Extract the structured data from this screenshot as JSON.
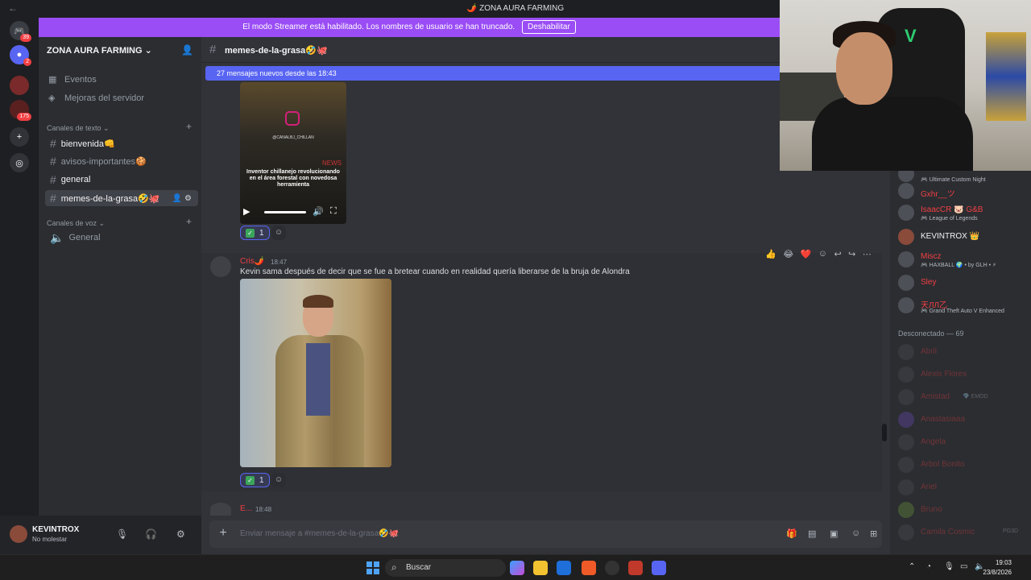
{
  "window": {
    "title": "🌶️ ZONA AURA FARMING",
    "back": "←"
  },
  "banner": {
    "text": "El modo Streamer está habilitado. Los nombres de usuario se han truncado.",
    "button": "Deshabilitar"
  },
  "guilds": [
    {
      "name": "discord-home",
      "badge": "39"
    },
    {
      "name": "server-2",
      "badge": "2"
    },
    {
      "name": "server-3",
      "badge": ""
    },
    {
      "name": "server-4",
      "badge": "175"
    }
  ],
  "sidebar": {
    "server_name": "ZONA AURA FARMING",
    "nav": [
      {
        "label": "Eventos",
        "icon": "calendar-icon"
      },
      {
        "label": "Mejoras del servidor",
        "icon": "boost-icon"
      }
    ],
    "text_category": "Canales de texto",
    "channels": [
      {
        "label": "bienvenida👊"
      },
      {
        "label": "avisos-importantes🍪"
      },
      {
        "label": "general"
      },
      {
        "label": "memes-de-la-grasa🤣🐙"
      }
    ],
    "voice_category": "Canales de voz",
    "voice_channels": [
      {
        "label": "General"
      }
    ]
  },
  "user": {
    "name": "KEVINTROX",
    "status": "No molestar"
  },
  "channel": {
    "name": "memes-de-la-grasa🤣🐙",
    "new_messages": "27 mensajes nuevos desde las 18:43"
  },
  "video": {
    "handle": "@CANALBJ_CHILLAN",
    "caption": "Inventor chillanejo revolucionando en el área forestal con novedosa herramienta",
    "news": "NEWS"
  },
  "reactions": {
    "count1": "1",
    "count2": "1"
  },
  "message": {
    "author": "Cris🌶️",
    "time": "18:47",
    "text": "Kevin sama después de decir que se fue a bretear cuando en realidad quería liberarse de la bruja de Alondra",
    "toolbar": [
      "👍",
      "😂",
      "❤️",
      "☺",
      "↩",
      "↪",
      "⋯"
    ]
  },
  "next_message": {
    "author": "E...",
    "time": "18:48"
  },
  "composer": {
    "placeholder": "Enviar mensaje a #memes-de-la-grasa🤣🐙"
  },
  "members": {
    "online": [
      {
        "name": "",
        "activity": "🎮 Ultimate Custom Night"
      },
      {
        "name": "Gxhr__ツ",
        "activity": ""
      },
      {
        "name": "IsaacCR 🐷 G&B",
        "activity": "🎮 League of Legends"
      },
      {
        "name": "KEVINTROX 👑",
        "activity": ""
      },
      {
        "name": "Miscz",
        "activity": "🎮 HAXBALL 🌍 • by GLH • ⚡"
      },
      {
        "name": "Sley",
        "activity": ""
      },
      {
        "name": "天ЛЛ乙",
        "activity": "🎮 Grand Theft Auto V Enhanced"
      }
    ],
    "offline_header": "Desconectado — 69",
    "offline": [
      {
        "name": "Abril",
        "activity": ""
      },
      {
        "name": "Alexis Flores",
        "activity": ""
      },
      {
        "name": "Amistad",
        "activity": "💎 EMOD"
      },
      {
        "name": "Anastasiaaa",
        "activity": ""
      },
      {
        "name": "Angela",
        "activity": ""
      },
      {
        "name": "Arbol Bonito",
        "activity": ""
      },
      {
        "name": "Ariel",
        "activity": ""
      },
      {
        "name": "Bruno",
        "activity": ""
      },
      {
        "name": "Camila Cosmic",
        "activity": "PG3D"
      }
    ]
  },
  "taskbar": {
    "search": "Buscar",
    "time": "19:03",
    "date": "23/8/2026"
  }
}
